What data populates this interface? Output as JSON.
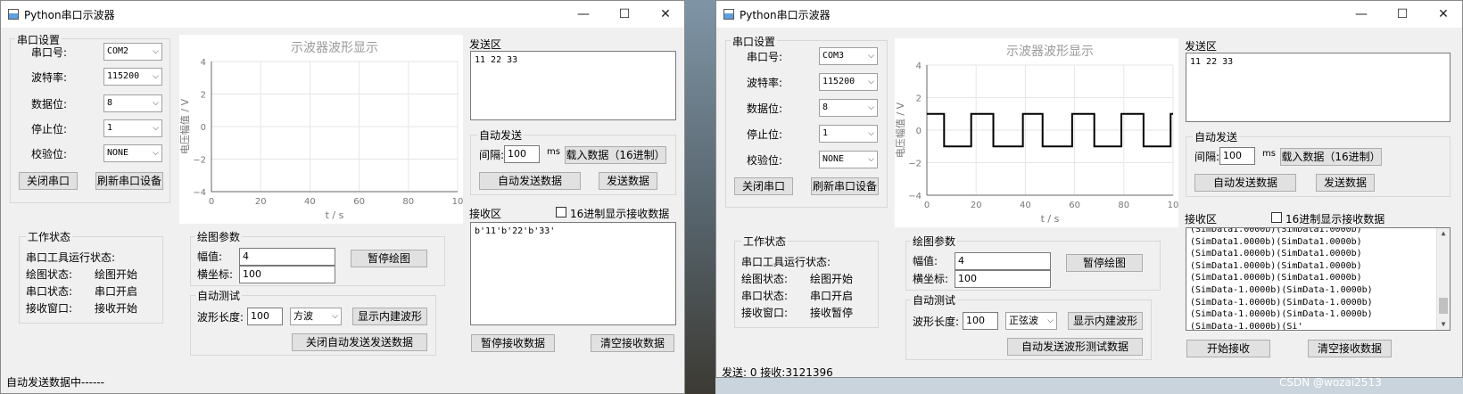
{
  "windows": [
    {
      "title": "Python串口示波器",
      "serial_settings": {
        "group_title": "串口设置",
        "fields": [
          {
            "label": "串口号:",
            "value": "COM2"
          },
          {
            "label": "波特率:",
            "value": "115200"
          },
          {
            "label": "数据位:",
            "value": "8"
          },
          {
            "label": "停止位:",
            "value": "1"
          },
          {
            "label": "校验位:",
            "value": "NONE"
          }
        ],
        "close_button": "关闭串口",
        "refresh_button": "刷新串口设备"
      },
      "plot": {
        "title": "示波器波形显示",
        "ylabel": "电压幅值 / V",
        "xlabel": "t / s",
        "yticks": [
          "4",
          "2",
          "0",
          "−2",
          "−4"
        ],
        "xticks": [
          "0",
          "20",
          "40",
          "60",
          "80",
          "10"
        ]
      },
      "chart_data": {
        "type": "line",
        "title": "示波器波形显示",
        "xlabel": "t / s",
        "ylabel": "电压幅值 / V",
        "xlim": [
          0,
          100
        ],
        "ylim": [
          -4,
          4
        ],
        "grid": true,
        "series": []
      },
      "send": {
        "title": "发送区",
        "content": "11 22 33",
        "auto_group": "自动发送",
        "interval_label": "间隔:",
        "interval_value": "100",
        "interval_unit": "ms",
        "load_button": "载入数据（16进制）",
        "auto_send_button": "自动发送数据",
        "send_button": "发送数据"
      },
      "receive": {
        "title": "接收区",
        "hex_label": "16进制显示接收数据",
        "content": "b'11'b'22'b'33'",
        "pause_button": "暂停接收数据",
        "clear_button": "清空接收数据",
        "has_scrollbar": false
      },
      "status": {
        "group_title": "工作状态",
        "heading": "串口工具运行状态:",
        "rows": [
          {
            "label": "绘图状态:",
            "value": "绘图开始"
          },
          {
            "label": "串口状态:",
            "value": "串口开启"
          },
          {
            "label": "接收窗口:",
            "value": "接收开始"
          }
        ]
      },
      "plot_params": {
        "group_title": "绘图参数",
        "amplitude_label": "幅值:",
        "amplitude_value": "4",
        "xaxis_label": "横坐标:",
        "xaxis_value": "100",
        "pause_button": "暂停绘图"
      },
      "auto_test": {
        "group_title": "自动测试",
        "wave_length_label": "波形长度:",
        "wave_length_value": "100",
        "wave_type": "方波",
        "show_wave_button": "显示内建波形",
        "auto_send_button": "关闭自动发送发送数据"
      },
      "statusbar": "自动发送数据中------"
    },
    {
      "title": "Python串口示波器",
      "serial_settings": {
        "group_title": "串口设置",
        "fields": [
          {
            "label": "串口号:",
            "value": "COM3"
          },
          {
            "label": "波特率:",
            "value": "115200"
          },
          {
            "label": "数据位:",
            "value": "8"
          },
          {
            "label": "停止位:",
            "value": "1"
          },
          {
            "label": "校验位:",
            "value": "NONE"
          }
        ],
        "close_button": "关闭串口",
        "refresh_button": "刷新串口设备"
      },
      "plot": {
        "title": "示波器波形显示",
        "ylabel": "电压幅值 / V",
        "xlabel": "t / s",
        "yticks": [
          "4",
          "2",
          "0",
          "−2",
          "−4"
        ],
        "xticks": [
          "0",
          "20",
          "40",
          "60",
          "80",
          "10"
        ]
      },
      "chart_data": {
        "type": "line",
        "title": "示波器波形显示",
        "xlabel": "t / s",
        "ylabel": "电压幅值 / V",
        "xlim": [
          0,
          100
        ],
        "ylim": [
          -4,
          4
        ],
        "grid": true,
        "series": [
          {
            "x": [
              0,
              7,
              7,
              18,
              18,
              27,
              27,
              39,
              39,
              47,
              47,
              59,
              59,
              68,
              68,
              79,
              79,
              88,
              88,
              99,
              99,
              100
            ],
            "y": [
              1,
              1,
              -1,
              -1,
              1,
              1,
              -1,
              -1,
              1,
              1,
              -1,
              -1,
              1,
              1,
              -1,
              -1,
              1,
              1,
              -1,
              -1,
              1,
              1
            ]
          }
        ]
      },
      "send": {
        "title": "发送区",
        "content": "11 22 33",
        "auto_group": "自动发送",
        "interval_label": "间隔:",
        "interval_value": "100",
        "interval_unit": "ms",
        "load_button": "载入数据（16进制）",
        "auto_send_button": "自动发送数据",
        "send_button": "发送数据"
      },
      "receive": {
        "title": "接收区",
        "hex_label": "16进制显示接收数据",
        "content": "(SimData1.0000b)(SimData1.0000b)\n(SimData1.0000b)(SimData1.0000b)\n(SimData1.0000b)(SimData1.0000b)\n(SimData1.0000b)(SimData1.0000b)\n(SimData1.0000b)(SimData1.0000b)\n(SimData-1.0000b)(SimData-1.0000b)\n(SimData-1.0000b)(SimData-1.0000b)\n(SimData-1.0000b)(SimData-1.0000b)\n(SimData-1.0000b)(Si'",
        "pause_button": "开始接收",
        "clear_button": "清空接收数据",
        "has_scrollbar": true
      },
      "status": {
        "group_title": "工作状态",
        "heading": "串口工具运行状态:",
        "rows": [
          {
            "label": "绘图状态:",
            "value": "绘图开始"
          },
          {
            "label": "串口状态:",
            "value": "串口开启"
          },
          {
            "label": "接收窗口:",
            "value": "接收暂停"
          }
        ]
      },
      "plot_params": {
        "group_title": "绘图参数",
        "amplitude_label": "幅值:",
        "amplitude_value": "4",
        "xaxis_label": "横坐标:",
        "xaxis_value": "100",
        "pause_button": "暂停绘图"
      },
      "auto_test": {
        "group_title": "自动测试",
        "wave_length_label": "波形长度:",
        "wave_length_value": "100",
        "wave_type": "正弦波",
        "show_wave_button": "显示内建波形",
        "auto_send_button": "自动发送波形测试数据"
      },
      "statusbar": "发送: 0  接收:3121396"
    }
  ],
  "watermark": "CSDN @wozai2513"
}
